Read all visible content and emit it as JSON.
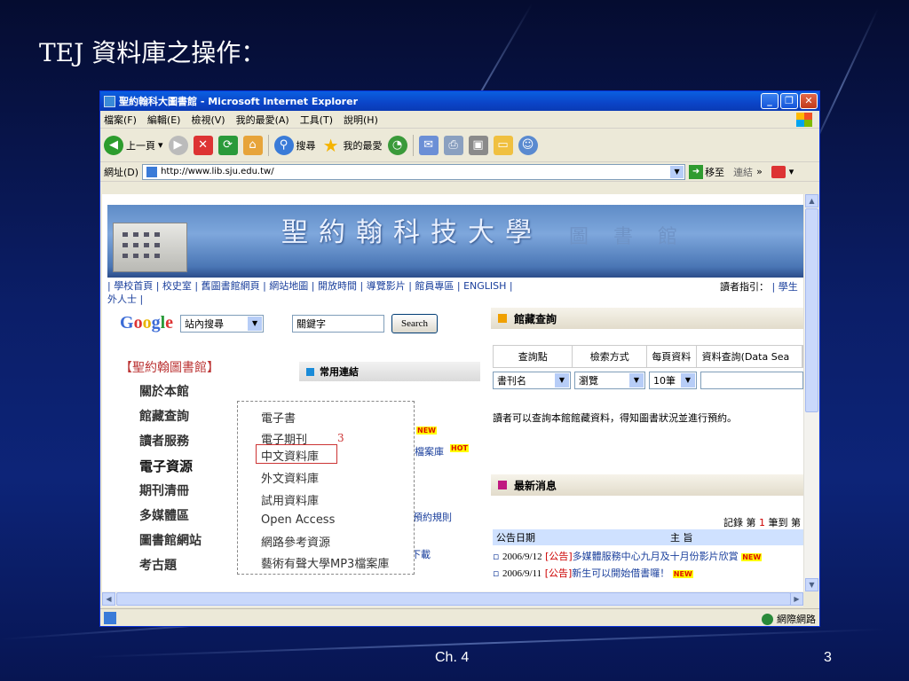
{
  "slide": {
    "title": "TEJ 資料庫之操作：",
    "footer_chapter": "Ch. 4",
    "page_number": "3"
  },
  "window": {
    "title": "聖約翰科大圖書館 - Microsoft Internet Explorer"
  },
  "menu": [
    "檔案(F)",
    "編輯(E)",
    "檢視(V)",
    "我的最愛(A)",
    "工具(T)",
    "說明(H)"
  ],
  "toolbar": {
    "back": "上一頁",
    "search": "搜尋",
    "favorites": "我的最愛"
  },
  "address": {
    "label": "網址(D)",
    "url": "http://www.lib.sju.edu.tw/",
    "go": "移至",
    "links": "連結"
  },
  "status": {
    "zone": "網際網路"
  },
  "page": {
    "banner_title": "聖約翰科技大學",
    "banner_sub": "圖書館",
    "nav_links": "| 學校首頁 | 校史室 | 舊圖書館網頁 | 網站地圖 | 開放時間 | 導覽影片 | 館員專區 | ENGLISH |",
    "nav_wrap": "外人士 |",
    "reader_guide_label": "讀者指引：",
    "reader_guide_link": "| 學生",
    "google": {
      "logo": "Google",
      "scope": "站內搜尋",
      "keyword": "關鍵字",
      "button": "Search"
    },
    "library_head": "【聖約翰圖書館】",
    "left_menu": [
      "關於本館",
      "館藏查詢",
      "讀者服務",
      "電子資源",
      "期刊清冊",
      "多媒體區",
      "圖書館網站",
      "考古題"
    ],
    "common_links_title": "常用連結",
    "peek_texts": [
      "檔案庫",
      "預約規則",
      "下載"
    ],
    "badges": {
      "new": "NEW",
      "hot": "HOT"
    },
    "popup": {
      "items": [
        "電子書",
        "電子期刊",
        "中文資料庫",
        "外文資料庫",
        "試用資料庫",
        "Open Access",
        "網路參考資源",
        "藝術有聲大學MP3檔案庫"
      ],
      "step_number": "3"
    },
    "collection": {
      "title": "館藏查詢",
      "headers": [
        "查詢點",
        "檢索方式",
        "每頁資料",
        "資料查詢(Data Sea"
      ],
      "selects": [
        "書刊名",
        "瀏覽",
        "10筆"
      ],
      "description": "讀者可以查詢本館館藏資料，得知圖書狀況並進行預約。"
    },
    "news": {
      "title": "最新消息",
      "count_prefix": "記錄 第",
      "count_num": "1",
      "count_suffix": "筆到 第",
      "col_date": "公告日期",
      "col_subject": "主 旨",
      "rows": [
        {
          "date": "2006/9/12",
          "tag": "[公告]",
          "text": "多媒體服務中心九月及十月份影片欣賞"
        },
        {
          "date": "2006/9/11",
          "tag": "[公告]",
          "text": "新生可以開始借書囉！"
        }
      ]
    }
  },
  "colors": {
    "title_bar": "#0a5fe0",
    "popup_highlight": "#cc3333",
    "collection_icon": "#f0a000",
    "news_icon": "#c01880",
    "slide_bg": "#0b1e68"
  }
}
